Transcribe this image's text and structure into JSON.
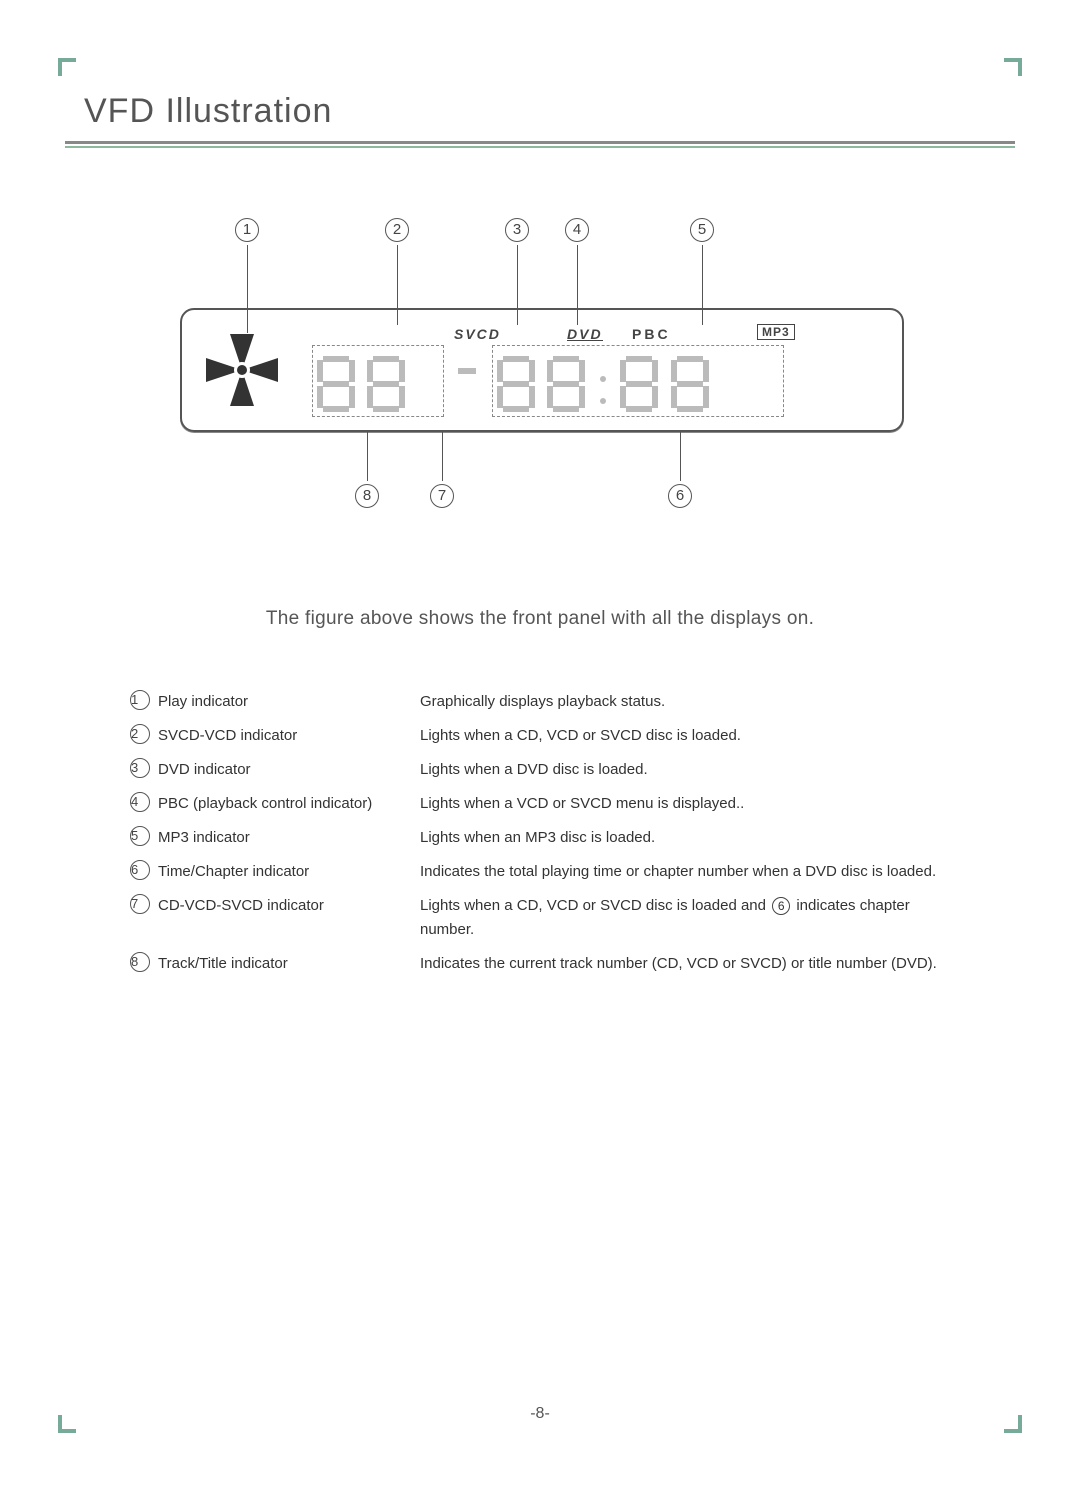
{
  "title": "VFD Illustration",
  "caption": "The figure above shows the front panel with all the displays on.",
  "page_number": "-8-",
  "callouts_top": [
    "1",
    "2",
    "3",
    "4",
    "5"
  ],
  "callouts_bottom": [
    "8",
    "7",
    "6"
  ],
  "panel_labels": {
    "svcd": "SVCD",
    "dvd": "DVD",
    "pbc": "PBC",
    "mp3": "MP3"
  },
  "legend": [
    {
      "n": "1",
      "name": "Play indicator",
      "desc": "Graphically displays playback status."
    },
    {
      "n": "2",
      "name": "SVCD-VCD indicator",
      "desc": "Lights when a CD, VCD or SVCD disc is loaded."
    },
    {
      "n": "3",
      "name": "DVD indicator",
      "desc": "Lights when a DVD disc is loaded."
    },
    {
      "n": "4",
      "name": "PBC (playback control indicator)",
      "desc": "Lights when a VCD or SVCD menu is displayed.."
    },
    {
      "n": "5",
      "name": "MP3 indicator",
      "desc": "Lights when an MP3 disc is loaded."
    },
    {
      "n": "6",
      "name": "Time/Chapter indicator",
      "desc": "Indicates the total playing time or chapter number when a DVD disc is loaded."
    },
    {
      "n": "7",
      "name": "CD-VCD-SVCD indicator",
      "desc_a": "Lights when a CD, VCD or SVCD disc is loaded and ",
      "desc_ref": "6",
      "desc_b": " indicates chapter number."
    },
    {
      "n": "8",
      "name": "Track/Title indicator",
      "desc": "Indicates the current track number (CD, VCD or SVCD) or title number (DVD)."
    }
  ]
}
